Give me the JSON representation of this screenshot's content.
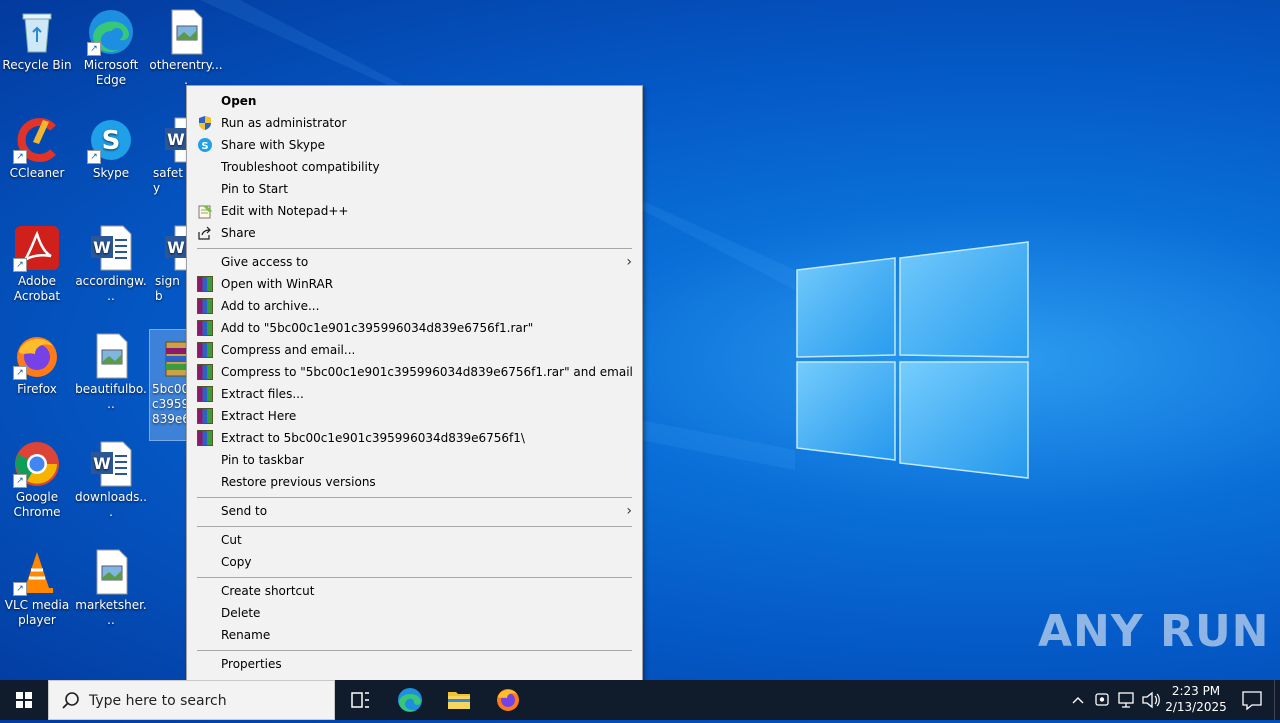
{
  "desktop": {
    "icons": [
      {
        "label": "Recycle Bin"
      },
      {
        "label": "Microsoft Edge"
      },
      {
        "label": "otherentry...."
      },
      {
        "label": "CCleaner"
      },
      {
        "label": "Skype"
      },
      {
        "label": "safety"
      },
      {
        "label": "Adobe Acrobat"
      },
      {
        "label": "accordingw..."
      },
      {
        "label": "signb"
      },
      {
        "label": "Firefox"
      },
      {
        "label": "beautifulbo..."
      },
      {
        "label": "5bc00c1e901c395996034d839e6756f1.rar"
      },
      {
        "label": "Google Chrome"
      },
      {
        "label": "downloads..."
      },
      {
        "label": "VLC media player"
      },
      {
        "label": "marketsher..."
      }
    ],
    "selected_icon_label": "5bc00c\nc3959\n839e67"
  },
  "context_menu": {
    "items": [
      {
        "label": "Open"
      },
      {
        "label": "Run as administrator",
        "icon": "shield-icon"
      },
      {
        "label": "Share with Skype",
        "icon": "skype-icon"
      },
      {
        "label": "Troubleshoot compatibility"
      },
      {
        "label": "Pin to Start"
      },
      {
        "label": "Edit with Notepad++",
        "icon": "notepad-plus-plus-icon"
      },
      {
        "label": "Share",
        "icon": "share-icon"
      },
      {
        "label": "Give access to",
        "submenu": true
      },
      {
        "label": "Open with WinRAR",
        "icon": "winrar-icon"
      },
      {
        "label": "Add to archive...",
        "icon": "winrar-icon"
      },
      {
        "label": "Add to \"5bc00c1e901c395996034d839e6756f1.rar\"",
        "icon": "winrar-icon"
      },
      {
        "label": "Compress and email...",
        "icon": "winrar-icon"
      },
      {
        "label": "Compress to \"5bc00c1e901c395996034d839e6756f1.rar\" and email",
        "icon": "winrar-icon"
      },
      {
        "label": "Extract files...",
        "icon": "winrar-icon"
      },
      {
        "label": "Extract Here",
        "icon": "winrar-icon"
      },
      {
        "label": "Extract to 5bc00c1e901c395996034d839e6756f1\\",
        "icon": "winrar-icon"
      },
      {
        "label": "Pin to taskbar"
      },
      {
        "label": "Restore previous versions"
      },
      {
        "label": "Send to",
        "submenu": true
      },
      {
        "label": "Cut"
      },
      {
        "label": "Copy"
      },
      {
        "label": "Create shortcut"
      },
      {
        "label": "Delete"
      },
      {
        "label": "Rename"
      },
      {
        "label": "Properties"
      }
    ],
    "submenu_arrow": "›"
  },
  "taskbar": {
    "search_placeholder": "Type here to search",
    "pinned": [
      {
        "name": "task-view-icon"
      },
      {
        "name": "edge-icon"
      },
      {
        "name": "file-explorer-icon"
      },
      {
        "name": "firefox-icon"
      }
    ],
    "clock_time": "2:23 PM",
    "clock_date": "2/13/2025"
  },
  "watermark": "ANY RUN"
}
